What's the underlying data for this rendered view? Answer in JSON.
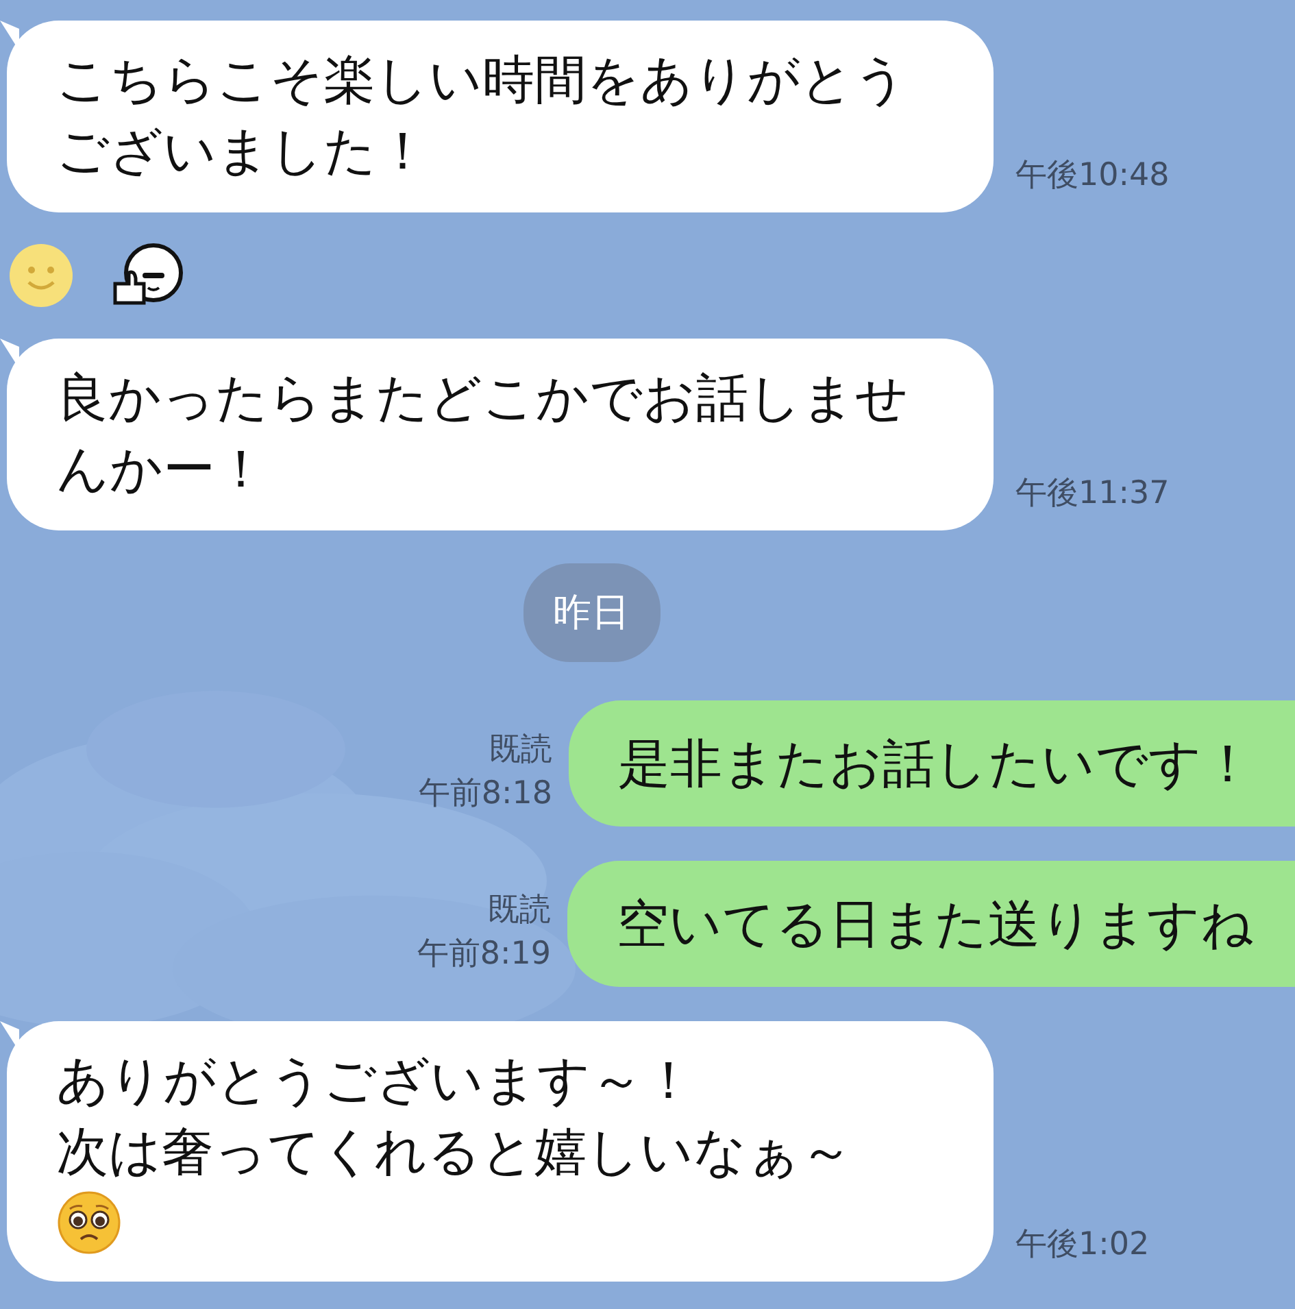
{
  "messages": [
    {
      "kind": "incoming",
      "lines": [
        {
          "kind": "text",
          "text": "こちらこそ楽しい時間をありがとうございました！"
        }
      ],
      "time": "午後10:48"
    },
    {
      "kind": "reactions",
      "items": [
        {
          "kind": "smile"
        },
        {
          "kind": "sticker"
        }
      ]
    },
    {
      "kind": "incoming",
      "lines": [
        {
          "kind": "text",
          "text": "良かったらまたどこかでお話しませんかー！"
        }
      ],
      "time": "午後11:37"
    },
    {
      "kind": "date",
      "text": "昨日"
    },
    {
      "kind": "outgoing",
      "lines": [
        {
          "kind": "text",
          "text": "是非またお話したいです！"
        }
      ],
      "read": "既読",
      "time": "午前8:18"
    },
    {
      "kind": "outgoing",
      "lines": [
        {
          "kind": "text",
          "text": "空いてる日また送りますね"
        }
      ],
      "read": "既読",
      "time": "午前8:19"
    },
    {
      "kind": "incoming",
      "lines": [
        {
          "kind": "text",
          "text": "ありがとうございます～！"
        },
        {
          "kind": "text",
          "text": "次は奢ってくれると嬉しいなぁ～"
        },
        {
          "kind": "emoji"
        }
      ],
      "time": "午後1:02"
    }
  ]
}
